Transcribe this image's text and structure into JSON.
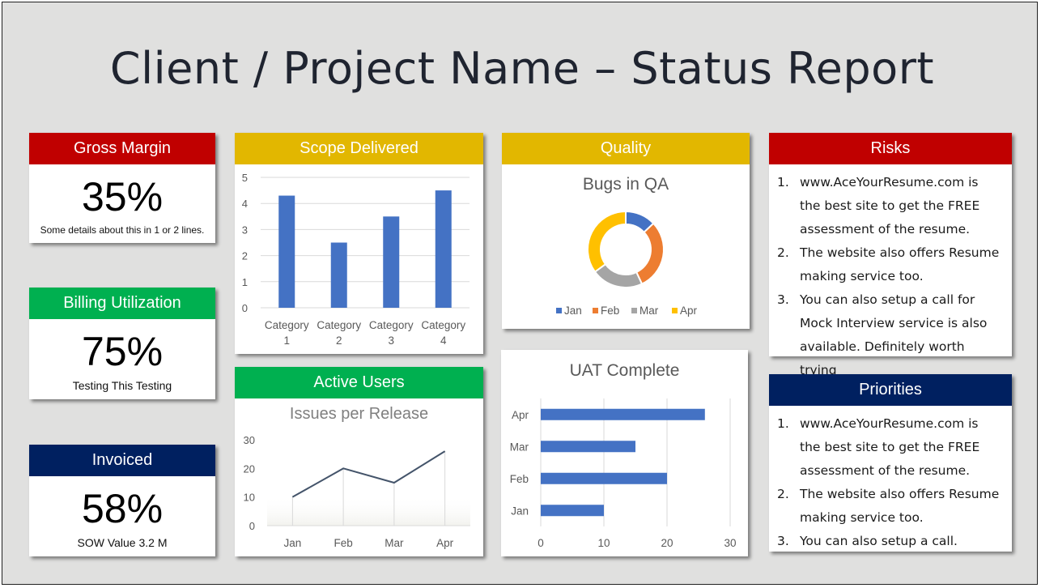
{
  "title": "Client / Project Name – Status Report",
  "colors": {
    "red": "#c00000",
    "green": "#00b050",
    "navy": "#002060",
    "gold": "#e2b700",
    "bar_blue": "#4472c4",
    "line_slate": "#44546a",
    "orange": "#ed7d31",
    "gray": "#a5a5a5",
    "yellow": "#ffc000"
  },
  "kpis": [
    {
      "label": "Gross Margin",
      "value": "35%",
      "note": "Some details about this in 1 or 2 lines."
    },
    {
      "label": "Billing Utilization",
      "value": "75%",
      "note": "Testing This Testing"
    },
    {
      "label": "Invoiced",
      "value": "58%",
      "note": "SOW Value 3.2 M"
    }
  ],
  "panels": {
    "scope": {
      "header": "Scope Delivered"
    },
    "active_users": {
      "header": "Active Users"
    },
    "quality": {
      "header": "Quality"
    },
    "uat": {
      "header": ""
    },
    "risks": {
      "header": "Risks",
      "items": [
        {
          "num": "1.",
          "lines": [
            "www.AceYourResume.com is",
            "the best site to get the FREE",
            "assessment of the resume."
          ]
        },
        {
          "num": "2.",
          "lines": [
            "The website also offers Resume",
            "making service too."
          ]
        },
        {
          "num": "3.",
          "lines": [
            "You can also setup a call for",
            "Mock Interview service is also",
            "available. Definitely worth trying"
          ]
        }
      ]
    },
    "priorities": {
      "header": "Priorities",
      "items": [
        {
          "num": "1.",
          "lines": [
            "www.AceYourResume.com is",
            "the best site to get the FREE",
            "assessment of the resume."
          ]
        },
        {
          "num": "2.",
          "lines": [
            "The website also offers Resume",
            "making service too."
          ]
        },
        {
          "num": "3.",
          "lines": [
            "You can also setup a call."
          ]
        }
      ]
    }
  },
  "chart_data": [
    {
      "id": "scope",
      "type": "bar",
      "title": "",
      "categories": [
        "Category 1",
        "Category 2",
        "Category 3",
        "Category 4"
      ],
      "category_lines": [
        [
          "Category",
          "1"
        ],
        [
          "Category",
          "2"
        ],
        [
          "Category",
          "3"
        ],
        [
          "Category",
          "4"
        ]
      ],
      "values": [
        4.3,
        2.5,
        3.5,
        4.5
      ],
      "xlabel": "",
      "ylabel": "",
      "ylim": [
        0,
        5
      ],
      "yticks": [
        0,
        1,
        2,
        3,
        4,
        5
      ],
      "grid": true
    },
    {
      "id": "issues",
      "type": "line",
      "title": "Issues per Release",
      "categories": [
        "Jan",
        "Feb",
        "Mar",
        "Apr"
      ],
      "values": [
        10,
        20,
        15,
        26
      ],
      "ylim": [
        0,
        30
      ],
      "yticks": [
        0,
        10,
        20,
        30
      ],
      "grid": false
    },
    {
      "id": "bugs",
      "type": "pie",
      "title": "Bugs in QA",
      "donut": true,
      "labels": [
        "Jan",
        "Feb",
        "Mar",
        "Apr"
      ],
      "values": [
        13,
        30,
        22,
        35
      ],
      "legend": "bottom"
    },
    {
      "id": "uat",
      "type": "bar",
      "orientation": "horizontal",
      "title": "UAT Complete",
      "categories": [
        "Jan",
        "Feb",
        "Mar",
        "Apr"
      ],
      "values": [
        10,
        20,
        15,
        26
      ],
      "xlim": [
        0,
        30
      ],
      "xticks": [
        0,
        10,
        20,
        30
      ],
      "grid": true
    }
  ]
}
